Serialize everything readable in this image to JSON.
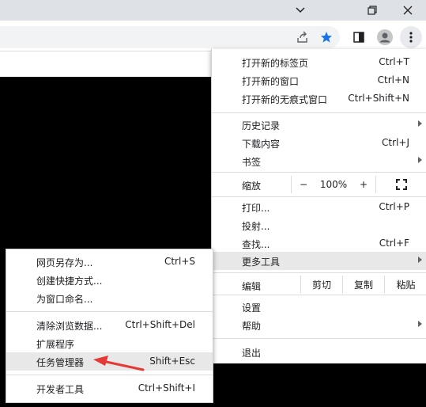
{
  "window": {
    "buttons": [
      "chevron-down",
      "restore",
      "close"
    ]
  },
  "menu": {
    "new_tab": {
      "label": "打开新的标签页",
      "shortcut": "Ctrl+T"
    },
    "new_window": {
      "label": "打开新的窗口",
      "shortcut": "Ctrl+N"
    },
    "new_incognito": {
      "label": "打开新的无痕式窗口",
      "shortcut": "Ctrl+Shift+N"
    },
    "history": {
      "label": "历史记录"
    },
    "downloads": {
      "label": "下载内容",
      "shortcut": "Ctrl+J"
    },
    "bookmarks": {
      "label": "书签"
    },
    "zoom": {
      "label": "缩放",
      "minus": "−",
      "value": "100%",
      "plus": "+"
    },
    "print": {
      "label": "打印...",
      "shortcut": "Ctrl+P"
    },
    "cast": {
      "label": "投射..."
    },
    "find": {
      "label": "查找...",
      "shortcut": "Ctrl+F"
    },
    "more_tools": {
      "label": "更多工具"
    },
    "edit": {
      "label": "编辑",
      "cut": "剪切",
      "copy": "复制",
      "paste": "粘贴"
    },
    "settings": {
      "label": "设置"
    },
    "help": {
      "label": "帮助"
    },
    "exit": {
      "label": "退出"
    }
  },
  "submenu": {
    "save_page": {
      "label": "网页另存为...",
      "shortcut": "Ctrl+S"
    },
    "create_shortcut": {
      "label": "创建快捷方式..."
    },
    "name_window": {
      "label": "为窗口命名..."
    },
    "clear_data": {
      "label": "清除浏览数据...",
      "shortcut": "Ctrl+Shift+Del"
    },
    "extensions": {
      "label": "扩展程序"
    },
    "task_manager": {
      "label": "任务管理器",
      "shortcut": "Shift+Esc"
    },
    "dev_tools": {
      "label": "开发者工具",
      "shortcut": "Ctrl+Shift+I"
    }
  },
  "colors": {
    "accent_star": "#1a73e8",
    "annotation_arrow": "#e53935",
    "highlight": "#e8e8e8"
  }
}
